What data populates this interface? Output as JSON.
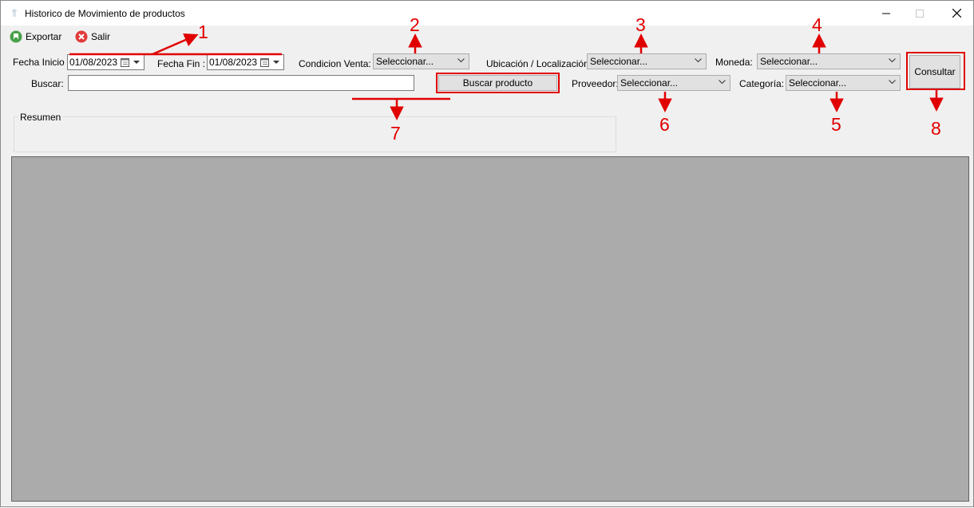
{
  "window": {
    "title": "Historico de Movimiento de productos",
    "minimize_icon": "minimize-icon",
    "maximize_icon": "maximize-icon",
    "close_icon": "close-icon"
  },
  "toolbar": {
    "export_label": "Exportar",
    "exit_label": "Salir"
  },
  "filters": {
    "fecha_inicio_label": "Fecha Inicio :",
    "fecha_inicio_value": "01/08/2023",
    "fecha_fin_label": "Fecha Fin :",
    "fecha_fin_value": "01/08/2023",
    "condicion_venta_label": "Condicion Venta:",
    "condicion_venta_value": "Seleccionar...",
    "ubicacion_label": "Ubicación / Localización:",
    "ubicacion_value": "Seleccionar...",
    "moneda_label": "Moneda:",
    "moneda_value": "Seleccionar...",
    "buscar_label": "Buscar:",
    "buscar_value": "",
    "buscar_producto_label": "Buscar producto",
    "proveedor_label": "Proveedor:",
    "proveedor_value": "Seleccionar...",
    "categoria_label": "Categoría:",
    "categoria_value": "Seleccionar...",
    "consultar_label": "Consultar"
  },
  "resumen": {
    "label": "Resumen"
  },
  "annotations": {
    "a1": "1",
    "a2": "2",
    "a3": "3",
    "a4": "4",
    "a5": "5",
    "a6": "6",
    "a7": "7",
    "a8": "8"
  },
  "colors": {
    "annotation_red": "#e00000",
    "grid_background": "#ababab",
    "window_background": "#f0f0f0"
  }
}
